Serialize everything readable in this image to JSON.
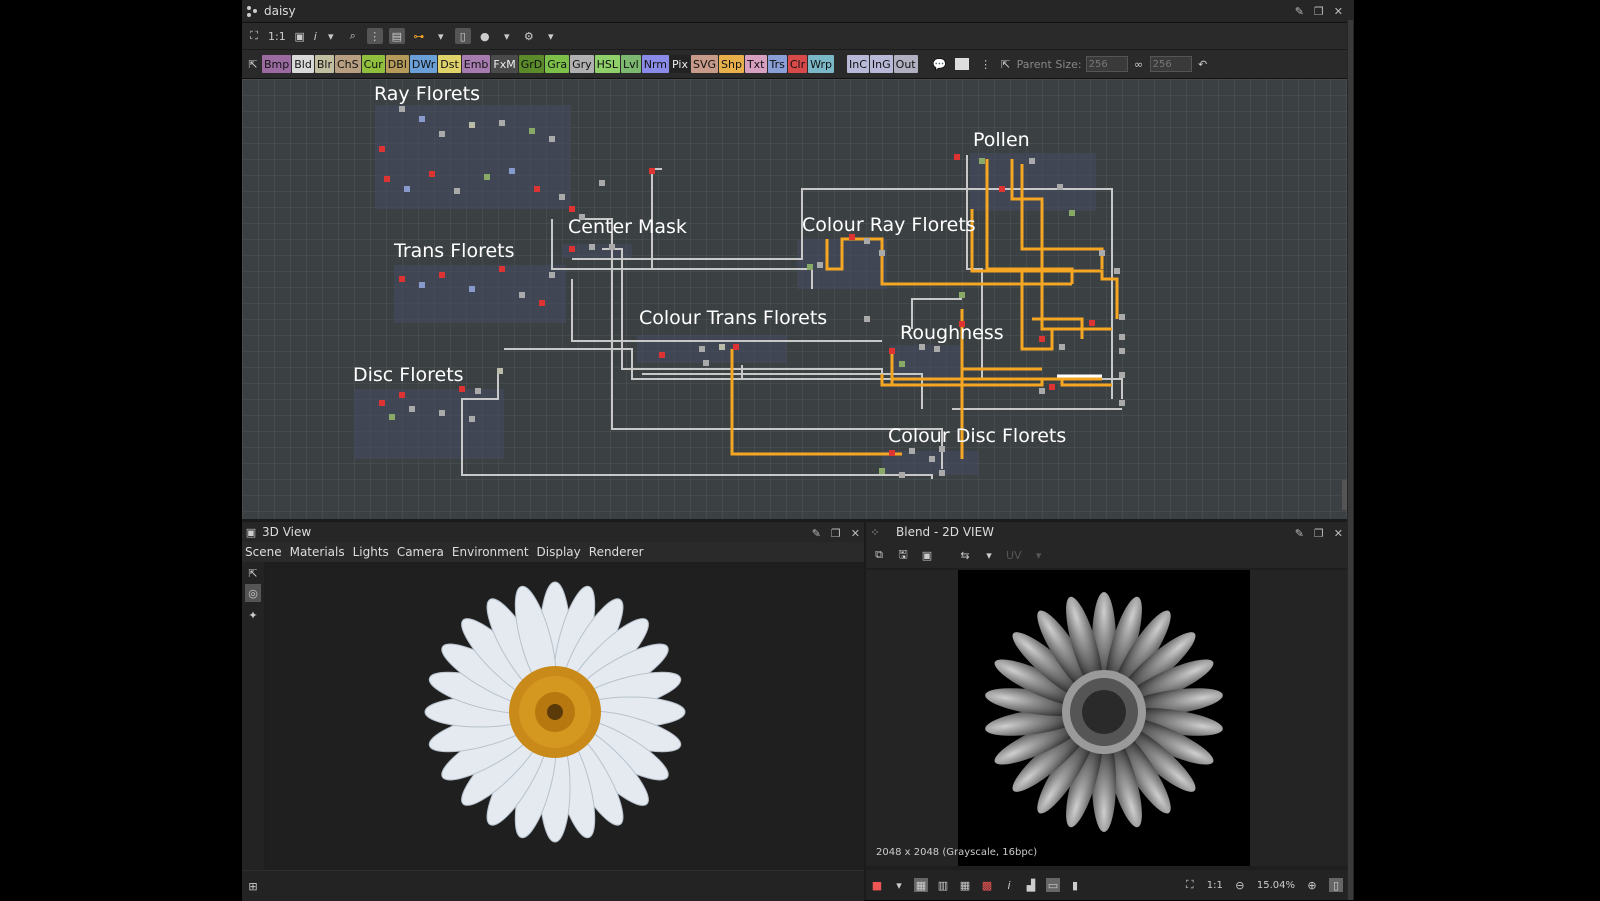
{
  "window": {
    "title": "daisy"
  },
  "toolbar": {
    "zoom_label": "1:1",
    "info_label": "i"
  },
  "node_buttons": [
    {
      "label": "Bmp",
      "color": "#9a6aa0"
    },
    {
      "label": "Bld",
      "color": "#d9d9d9"
    },
    {
      "label": "Blr",
      "color": "#c2bfa0"
    },
    {
      "label": "ChS",
      "color": "#b89f82"
    },
    {
      "label": "Cur",
      "color": "#8fbf3c"
    },
    {
      "label": "DBl",
      "color": "#b59a5a"
    },
    {
      "label": "DWr",
      "color": "#6a9fd8"
    },
    {
      "label": "Dst",
      "color": "#e0d36a"
    },
    {
      "label": "Emb",
      "color": "#a57bb0"
    },
    {
      "label": "FxM",
      "color": "#4a4a4a"
    },
    {
      "label": "GrD",
      "color": "#5a8a2a"
    },
    {
      "label": "Gra",
      "color": "#7cc04a"
    },
    {
      "label": "Gry",
      "color": "#b0b0b0"
    },
    {
      "label": "HSL",
      "color": "#8fd06a"
    },
    {
      "label": "Lvl",
      "color": "#7cb870"
    },
    {
      "label": "Nrm",
      "color": "#8a8ae8"
    },
    {
      "label": "Pix",
      "color": "#222222"
    },
    {
      "label": "SVG",
      "color": "#c89a8a"
    },
    {
      "label": "Shp",
      "color": "#e8b04a"
    },
    {
      "label": "Txt",
      "color": "#d8a0c0"
    },
    {
      "label": "Trs",
      "color": "#8a9fd8"
    },
    {
      "label": "Clr",
      "color": "#d84a4a"
    },
    {
      "label": "Wrp",
      "color": "#7ab8c8"
    },
    {
      "label": "InC",
      "color": "#b8b8d8"
    },
    {
      "label": "InG",
      "color": "#b8b8d8"
    },
    {
      "label": "Out",
      "color": "#b0b0c0"
    }
  ],
  "parent_size": {
    "label": "Parent Size:",
    "width": "256",
    "height": "256"
  },
  "frames": [
    {
      "title": "Ray Florets"
    },
    {
      "title": "Pollen"
    },
    {
      "title": "Center Mask"
    },
    {
      "title": "Colour Ray Florets"
    },
    {
      "title": "Trans Florets"
    },
    {
      "title": "Colour Trans Florets"
    },
    {
      "title": "Roughness"
    },
    {
      "title": "Disc Florets"
    },
    {
      "title": "Colour Disc Florets"
    }
  ],
  "view3d": {
    "title": "3D View",
    "menu": [
      "Scene",
      "Materials",
      "Lights",
      "Camera",
      "Environment",
      "Display",
      "Renderer"
    ]
  },
  "view2d": {
    "title": "Blend - 2D VIEW",
    "uv_label": "UV",
    "image_info": "2048 x 2048 (Grayscale, 16bpc)",
    "zoom_ratio": "1:1",
    "zoom_percent": "15.04%"
  },
  "colors": {
    "accent_wire": "#f5a623",
    "gray_wire": "#c8c8c8",
    "graph_bg": "#3b4042",
    "frame_bg": "#464b64"
  }
}
